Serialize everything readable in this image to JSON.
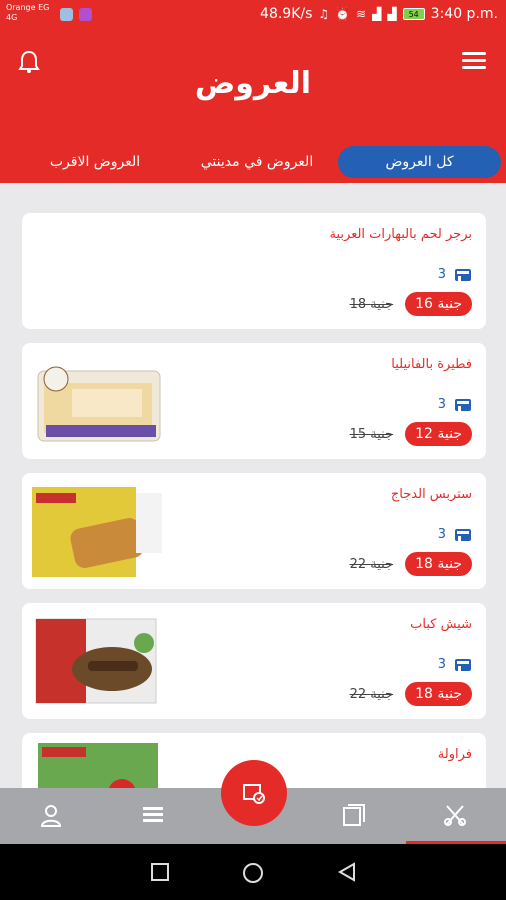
{
  "status_bar": {
    "carrier": "Orange EG",
    "carrier_sub": "4G",
    "speed": "48.9K/s",
    "battery": "54",
    "time": "3:40 p.m."
  },
  "header": {
    "title": "العروض"
  },
  "tabs": [
    {
      "label": "كل العروض",
      "active": true
    },
    {
      "label": "العروض في مدينتي",
      "active": false
    },
    {
      "label": "العروض الاقرب",
      "active": false
    }
  ],
  "offers": [
    {
      "title": "برجر لحم بالبهارات العربية",
      "stores": "3",
      "old_price": "18 جنية",
      "new_price": "16 جنية",
      "image": "none"
    },
    {
      "title": "فطيرة بالفانيليا",
      "stores": "3",
      "old_price": "15 جنية",
      "new_price": "12 جنية",
      "image": "vanilla-pastry"
    },
    {
      "title": "ستربس الدجاج",
      "stores": "3",
      "old_price": "22 جنية",
      "new_price": "18 جنية",
      "image": "chicken-strips"
    },
    {
      "title": "شيش كباب",
      "stores": "3",
      "old_price": "22 جنية",
      "new_price": "18 جنية",
      "image": "shish-kebab"
    },
    {
      "title": "فراولة",
      "stores": "",
      "old_price": "",
      "new_price": "",
      "image": "strawberry"
    }
  ],
  "bottom_nav": [
    "profile-icon",
    "list-icon",
    "scan-icon",
    "catalog-icon",
    "offers-icon"
  ],
  "colors": {
    "primary": "#e52b27",
    "accent": "#2460b3",
    "nav": "#a6a7aa"
  }
}
